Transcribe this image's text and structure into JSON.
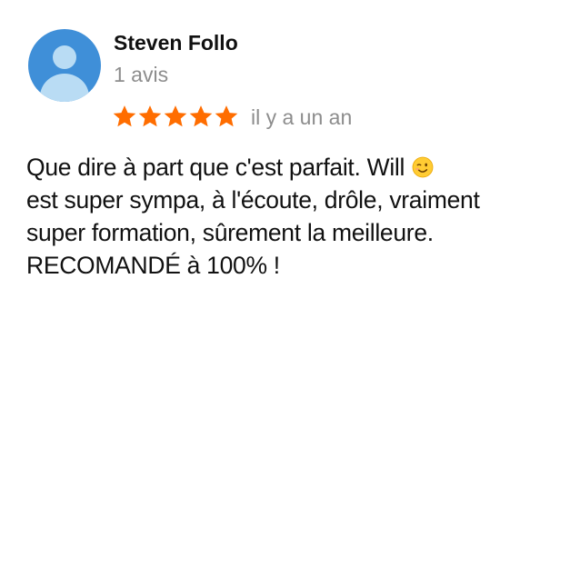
{
  "reviewer": {
    "name": "Steven Follo",
    "review_count": "1 avis",
    "avatar_icon": "person-avatar-icon",
    "avatar_color": "#3f8fd8"
  },
  "rating": {
    "stars": 5,
    "max": 5,
    "star_color": "#ff6d00",
    "icon": "star-icon"
  },
  "review": {
    "date": "il y a un an",
    "lines": [
      "Que dire à part que c'est parfait. Will",
      "est super sympa, à l'écoute, drôle, vraiment",
      "super formation, sûrement la meilleure.",
      "RECOMANDÉ à 100% !"
    ],
    "emoji": "winking-face-emoji"
  },
  "colors": {
    "text": "#111111",
    "muted": "#8d8d8d"
  }
}
